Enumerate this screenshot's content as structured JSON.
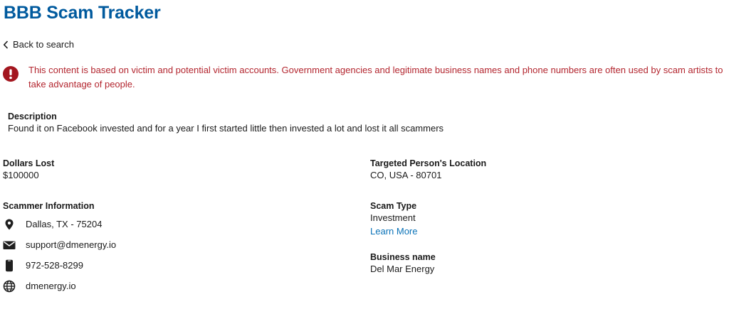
{
  "header": {
    "title": "BBB Scam Tracker"
  },
  "nav": {
    "back_label": "Back to search"
  },
  "alert": {
    "text": "This content is based on victim and potential victim accounts. Government agencies and legitimate business names and phone numbers are often used by scam artists to take advantage of people.",
    "color": "#b3262f"
  },
  "description": {
    "label": "Description",
    "text": "Found it on Facebook invested and for a year I first started little then invested a lot and lost it all scammers"
  },
  "dollars_lost": {
    "label": "Dollars Lost",
    "value": "$100000"
  },
  "targeted_location": {
    "label": "Targeted Person's Location",
    "value": "CO, USA - 80701"
  },
  "scammer_info": {
    "label": "Scammer Information",
    "address": {
      "icon": "location-pin-icon",
      "value": "Dallas, TX - 75204"
    },
    "email": {
      "icon": "envelope-icon",
      "value": "support@dmenergy.io"
    },
    "phone": {
      "icon": "phone-icon",
      "value": "972-528-8299"
    },
    "website": {
      "icon": "globe-icon",
      "value": "dmenergy.io"
    }
  },
  "scam_type": {
    "label": "Scam Type",
    "value": "Investment",
    "link_label": "Learn More"
  },
  "business": {
    "label": "Business name",
    "value": "Del Mar Energy"
  },
  "colors": {
    "brand": "#005a9e",
    "link": "#0b73b8",
    "alert": "#b3262f"
  }
}
